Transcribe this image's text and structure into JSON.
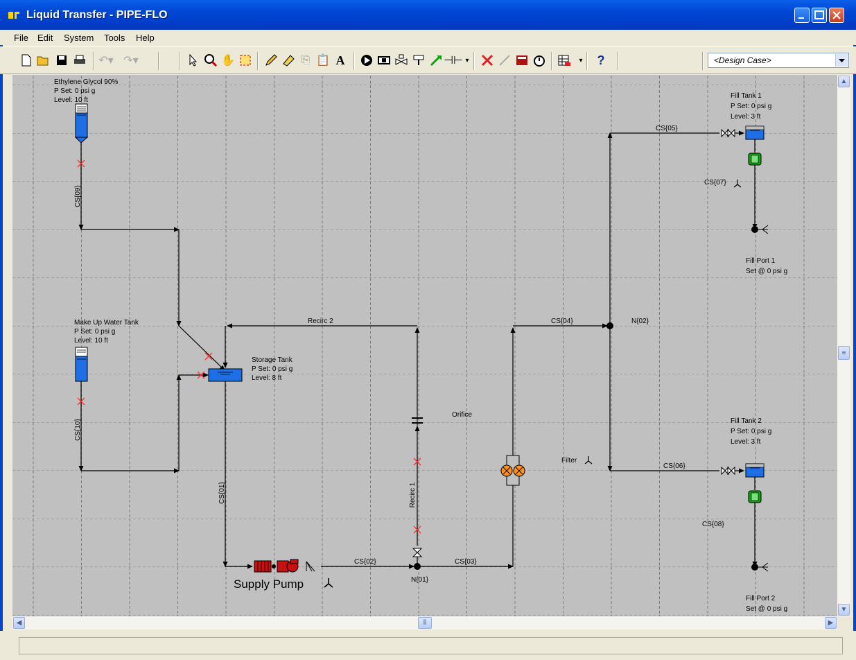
{
  "window": {
    "title": "Liquid Transfer  - PIPE-FLO"
  },
  "menu": [
    "File",
    "Edit",
    "System",
    "Tools",
    "Help"
  ],
  "toolbar": {
    "design_case": "<Design Case>",
    "icons": [
      "new-icon",
      "open-icon",
      "save-icon",
      "print-icon",
      "undo-icon",
      "redo-icon",
      "select-icon",
      "zoom-icon",
      "pan-icon",
      "zoom-extents-icon",
      "pencil-icon",
      "eraser-icon",
      "copy-icon",
      "paste-icon",
      "text-icon",
      "pump-icon",
      "component-icon",
      "valve-icon",
      "control-valve-icon",
      "flow-demand-icon",
      "node-icon",
      "delete-icon",
      "line-icon",
      "calculate-icon",
      "timer-icon",
      "table-icon",
      "help-icon"
    ]
  },
  "diagram": {
    "tanks": [
      {
        "name": "Ethylene Glycol 90%",
        "pset": "P Set: 0 psi g",
        "level": "Level: 10 ft"
      },
      {
        "name": "Make Up Water Tank",
        "pset": "P Set: 0 psi g",
        "level": "Level: 10 ft"
      },
      {
        "name": "Storage Tank",
        "pset": "P Set: 0 psi g",
        "level": "Level: 8 ft"
      },
      {
        "name": "Fill Tank 1",
        "pset": "P Set: 0 psi g",
        "level": "Level: 3 ft"
      },
      {
        "name": "Fill Tank 2",
        "pset": "P Set: 0 psi g",
        "level": "Level: 3 ft"
      }
    ],
    "pipes": [
      "CS{01}",
      "CS{02}",
      "CS{03}",
      "CS{04}",
      "CS{05}",
      "CS{06}",
      "CS{07}",
      "CS{08}",
      "CS{09}",
      "CS{10}",
      "Recirc 1",
      "Recirc 2"
    ],
    "nodes": [
      "N{01}",
      "N{02}"
    ],
    "components": {
      "pump": "Supply Pump",
      "orifice": "Orifice",
      "filter": "Filter"
    },
    "fill_ports": [
      {
        "name": "Fill Port 1",
        "set": "Set @ 0 psi g"
      },
      {
        "name": "Fill Port 2",
        "set": "Set @ 0 psi g"
      }
    ]
  },
  "colors": {
    "canvas": "#c0c0c0",
    "tank_fill": "#1e6fe6",
    "break_mark": "#ff3030",
    "pump": "#c81010",
    "meter": "#10a010",
    "filter": "#ff9020"
  }
}
